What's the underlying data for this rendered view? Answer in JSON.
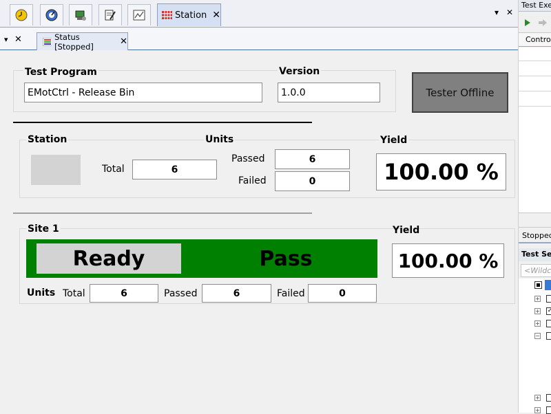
{
  "top_tabs": {
    "station_label": "Station",
    "close_glyph": "✕",
    "window_menu_glyph": "▾",
    "window_close_glyph": "✕"
  },
  "sub_tabs": {
    "menu_glyph": "▾",
    "close_glyph": "✕",
    "status_label": "Status [Stopped]",
    "status_close": "✕"
  },
  "program": {
    "test_program_label": "Test Program",
    "test_program_value": "EMotCtrl - Release Bin",
    "version_label": "Version",
    "version_value": "1.0.0",
    "tester_button": "Tester Offline"
  },
  "station": {
    "station_label": "Station",
    "units_label": "Units",
    "total_label": "Total",
    "total_value": "6",
    "passed_label": "Passed",
    "passed_value": "6",
    "failed_label": "Failed",
    "failed_value": "0",
    "yield_label": "Yield",
    "yield_value": "100.00 %"
  },
  "site": {
    "site_label": "Site 1",
    "state_text": "Ready",
    "result_text": "Pass",
    "result_color": "#008000",
    "yield_label": "Yield",
    "yield_value": "100.00 %",
    "units_label": "Units",
    "total_label": "Total",
    "total_value": "6",
    "passed_label": "Passed",
    "passed_value": "6",
    "failed_label": "Failed",
    "failed_value": "0"
  },
  "right_dock": {
    "test_exec_title": "Test Exe",
    "control_tab": "Contro",
    "stopped_text": "Stopped",
    "test_sel_title": "Test Sel",
    "wildcard_placeholder": "<Wildca"
  },
  "icons": [
    "clock-icon",
    "gauge-icon",
    "tester-icon",
    "edit-icon",
    "chart-icon",
    "station-icon",
    "status-list-icon",
    "play-icon",
    "step-icon"
  ]
}
